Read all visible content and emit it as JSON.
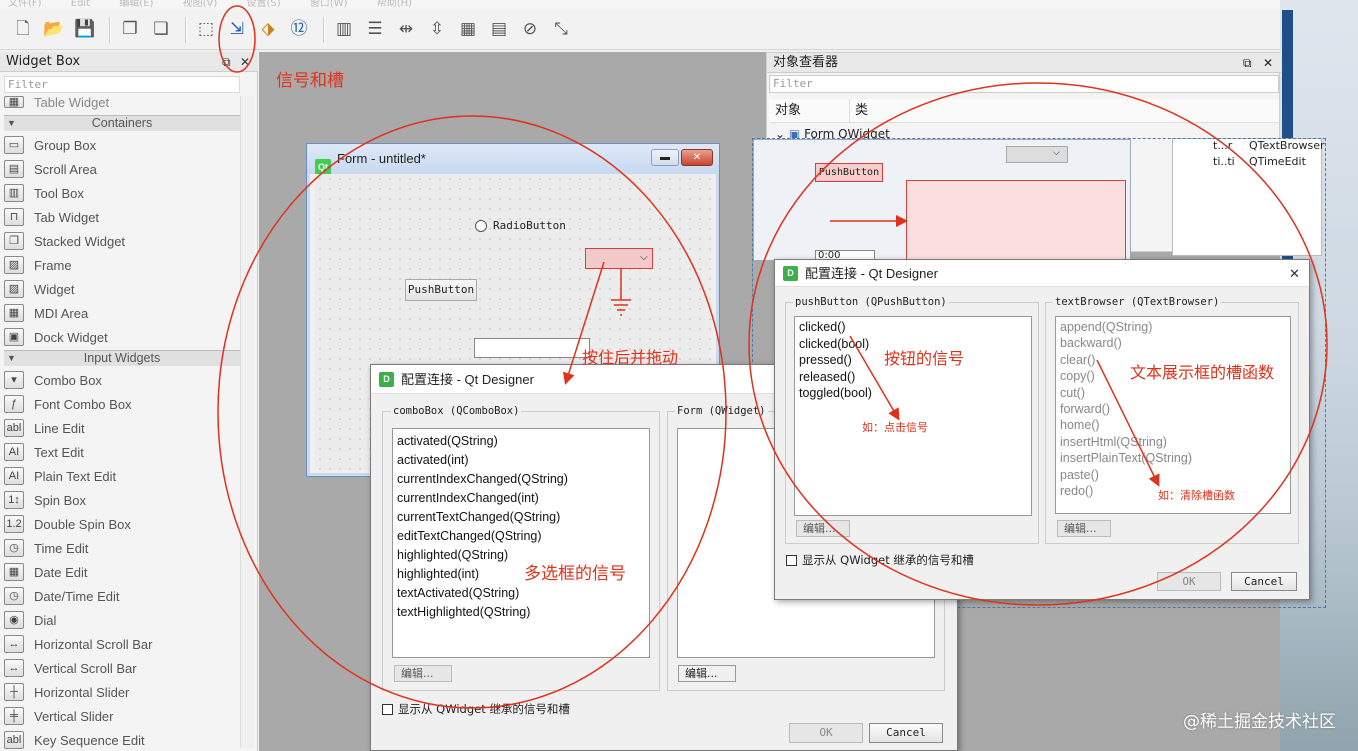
{
  "menubar": {
    "items": [
      "文件(F)",
      "Edit",
      "编辑(E)",
      "视图(V)",
      "设置(S)",
      "窗口(W)",
      "帮助(H)"
    ]
  },
  "toolbar": {
    "buttons": [
      "new-file-icon",
      "open-folder-icon",
      "save-icon",
      "window-icon",
      "window-stack-icon",
      "edit-widgets-icon",
      "edit-signals-slots-icon",
      "edit-buddies-icon",
      "edit-tab-order-icon",
      "layout-horizontal-icon",
      "layout-vertical-icon",
      "layout-horizontal-splitter-icon",
      "layout-vertical-splitter-icon",
      "layout-grid-icon",
      "layout-form-icon",
      "break-layout-icon",
      "adjust-size-icon"
    ]
  },
  "widget_box": {
    "title": "Widget Box",
    "filter_placeholder": "Filter",
    "partial_item": "Table Widget",
    "containers_label": "Containers",
    "containers": [
      {
        "label": "Group Box",
        "icon": "group-box-icon",
        "glyph": "▭"
      },
      {
        "label": "Scroll Area",
        "icon": "scroll-area-icon",
        "glyph": "▤"
      },
      {
        "label": "Tool Box",
        "icon": "tool-box-icon",
        "glyph": "▥"
      },
      {
        "label": "Tab Widget",
        "icon": "tab-widget-icon",
        "glyph": "⊓"
      },
      {
        "label": "Stacked Widget",
        "icon": "stacked-widget-icon",
        "glyph": "❐"
      },
      {
        "label": "Frame",
        "icon": "frame-icon",
        "glyph": "▨"
      },
      {
        "label": "Widget",
        "icon": "widget-icon",
        "glyph": "▨"
      },
      {
        "label": "MDI Area",
        "icon": "mdi-area-icon",
        "glyph": "▦"
      },
      {
        "label": "Dock Widget",
        "icon": "dock-widget-icon",
        "glyph": "▣"
      }
    ],
    "inputs_label": "Input Widgets",
    "inputs": [
      {
        "label": "Combo Box",
        "icon": "combo-box-icon",
        "glyph": "▾"
      },
      {
        "label": "Font Combo Box",
        "icon": "font-combo-box-icon",
        "glyph": "ƒ"
      },
      {
        "label": "Line Edit",
        "icon": "line-edit-icon",
        "glyph": "abl"
      },
      {
        "label": "Text Edit",
        "icon": "text-edit-icon",
        "glyph": "AI"
      },
      {
        "label": "Plain Text Edit",
        "icon": "plain-text-edit-icon",
        "glyph": "AI"
      },
      {
        "label": "Spin Box",
        "icon": "spin-box-icon",
        "glyph": "1↕"
      },
      {
        "label": "Double Spin Box",
        "icon": "double-spin-box-icon",
        "glyph": "1.2"
      },
      {
        "label": "Time Edit",
        "icon": "time-edit-icon",
        "glyph": "◷"
      },
      {
        "label": "Date Edit",
        "icon": "date-edit-icon",
        "glyph": "▦"
      },
      {
        "label": "Date/Time Edit",
        "icon": "datetime-edit-icon",
        "glyph": "◷"
      },
      {
        "label": "Dial",
        "icon": "dial-icon",
        "glyph": "◉"
      },
      {
        "label": "Horizontal Scroll Bar",
        "icon": "horizontal-scroll-bar-icon",
        "glyph": "↔"
      },
      {
        "label": "Vertical Scroll Bar",
        "icon": "vertical-scroll-bar-icon",
        "glyph": "↔"
      },
      {
        "label": "Horizontal Slider",
        "icon": "horizontal-slider-icon",
        "glyph": "┼"
      },
      {
        "label": "Vertical Slider",
        "icon": "vertical-slider-icon",
        "glyph": "╪"
      },
      {
        "label": "Key Sequence Edit",
        "icon": "key-sequence-edit-icon",
        "glyph": "abl"
      }
    ]
  },
  "form": {
    "title": "Form - untitled*",
    "radio_label": "RadioButton",
    "push_label": "PushButton"
  },
  "annotations": {
    "signals_slots": "信号和槽",
    "press_drag": "按住后并拖动",
    "combo_signals": "多选框的信号",
    "button_signals": "按钮的信号",
    "textbrowser_slots": "文本展示框的槽函数",
    "click_signal": "如：点击信号",
    "clear_slot": "如：清除槽函数"
  },
  "inspector": {
    "title": "对象查看器",
    "filter_placeholder": "Filter",
    "col_object": "对象",
    "col_class": "类",
    "root_label": "Form QWidget",
    "rows": [
      {
        "object": "t...r",
        "class": "QTextBrowser"
      },
      {
        "object": "ti..ti",
        "class": "QTimeEdit"
      }
    ]
  },
  "form2": {
    "push_label": "PushButton",
    "time_value": "0:00"
  },
  "dialog1": {
    "title": "配置连接 - Qt Designer",
    "left_group": "comboBox (QComboBox)",
    "right_group": "Form (QWidget)",
    "signals": [
      "activated(QString)",
      "activated(int)",
      "currentIndexChanged(QString)",
      "currentIndexChanged(int)",
      "currentTextChanged(QString)",
      "editTextChanged(QString)",
      "highlighted(QString)",
      "highlighted(int)",
      "textActivated(QString)",
      "textHighlighted(QString)"
    ],
    "edit_label": "编辑...",
    "inherit_label": "显示从 QWidget 继承的信号和槽",
    "ok_label": "OK",
    "cancel_label": "Cancel"
  },
  "dialog2": {
    "title": "配置连接 - Qt Designer",
    "left_group": "pushButton (QPushButton)",
    "right_group": "textBrowser (QTextBrowser)",
    "signals": [
      "clicked()",
      "clicked(bool)",
      "pressed()",
      "released()",
      "toggled(bool)"
    ],
    "slots": [
      "append(QString)",
      "backward()",
      "clear()",
      "copy()",
      "cut()",
      "forward()",
      "home()",
      "insertHtml(QString)",
      "insertPlainText(QString)",
      "paste()",
      "redo()"
    ],
    "edit_label": "编辑...",
    "inherit_label": "显示从 QWidget 继承的信号和槽",
    "ok_label": "OK",
    "cancel_label": "Cancel"
  },
  "watermark": "@稀土掘金技术社区",
  "colors": {
    "annotation": "#e0311a",
    "window_border": "#6a8fc2",
    "canvas": "#a9a9a9"
  }
}
